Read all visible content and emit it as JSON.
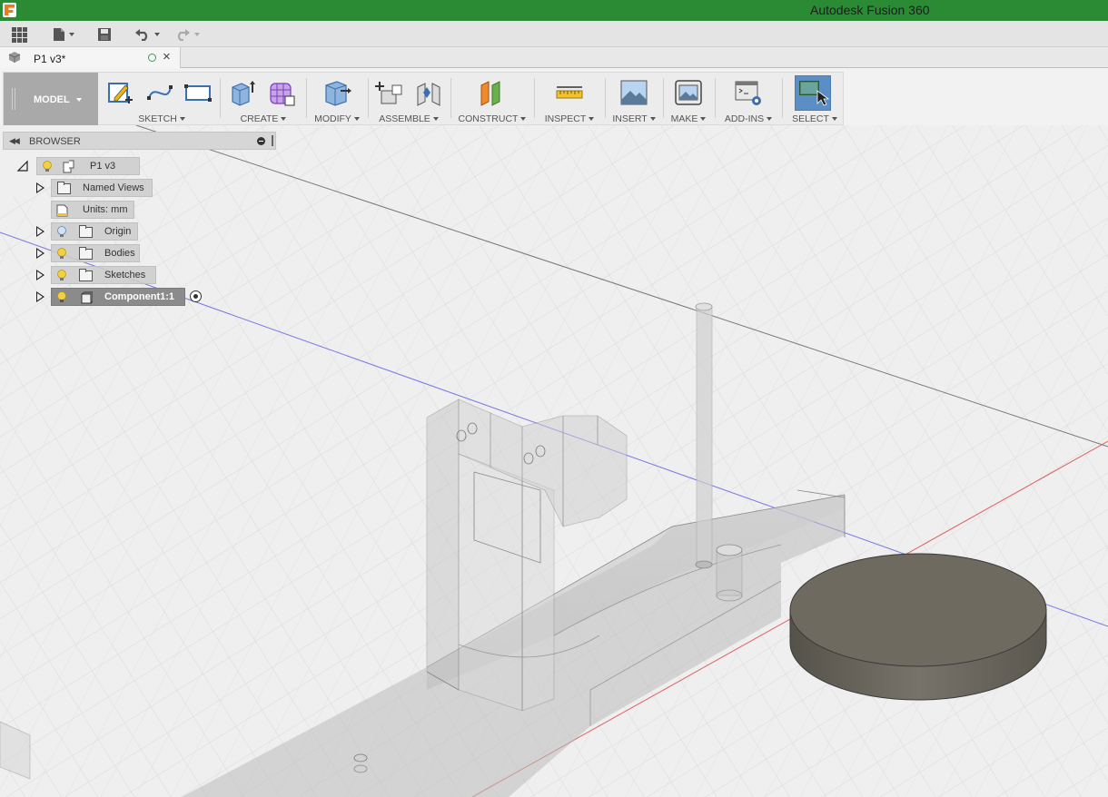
{
  "app": {
    "title": "Autodesk Fusion 360",
    "logo_icon": "fusion-logo-icon"
  },
  "quick_access": {
    "items": [
      {
        "name": "data-panel",
        "icon": "grid-icon"
      },
      {
        "name": "file-menu",
        "icon": "file-icon"
      },
      {
        "name": "save",
        "icon": "save-icon"
      },
      {
        "name": "undo",
        "icon": "undo-icon"
      },
      {
        "name": "redo",
        "icon": "redo-icon",
        "enabled": false
      }
    ]
  },
  "document_tab": {
    "title": "P1 v3*",
    "status": "saved-status-icon"
  },
  "workspace": {
    "label": "MODEL"
  },
  "toolbar": {
    "groups": [
      {
        "label": "SKETCH",
        "icons": [
          "create-sketch-icon",
          "spline-icon",
          "rectangle-icon"
        ]
      },
      {
        "label": "CREATE",
        "icons": [
          "extrude-icon",
          "form-icon"
        ]
      },
      {
        "label": "MODIFY",
        "icons": [
          "press-pull-icon"
        ]
      },
      {
        "label": "ASSEMBLE",
        "icons": [
          "new-component-icon",
          "joint-icon"
        ]
      },
      {
        "label": "CONSTRUCT",
        "icons": [
          "offset-plane-icon"
        ]
      },
      {
        "label": "INSPECT",
        "icons": [
          "measure-icon"
        ]
      },
      {
        "label": "INSERT",
        "icons": [
          "insert-image-icon"
        ]
      },
      {
        "label": "MAKE",
        "icons": [
          "3d-print-icon"
        ]
      },
      {
        "label": "ADD-INS",
        "icons": [
          "scripts-icon"
        ]
      },
      {
        "label": "SELECT",
        "icons": [
          "select-icon"
        ]
      }
    ]
  },
  "browser": {
    "title": "BROWSER",
    "root": {
      "label": "P1 v3"
    },
    "items": [
      {
        "label": "Named Views",
        "type": "folder",
        "visible_toggle": false
      },
      {
        "label": "Units: mm",
        "type": "units"
      },
      {
        "label": "Origin",
        "type": "folder",
        "bulb": "off"
      },
      {
        "label": "Bodies",
        "type": "folder",
        "bulb": "on"
      },
      {
        "label": "Sketches",
        "type": "folder",
        "bulb": "on"
      },
      {
        "label": "Component1:1",
        "type": "component",
        "bulb": "on",
        "active": true
      }
    ]
  },
  "colors": {
    "title_bar": "#2b8a34",
    "select_active": "#5b8ec4",
    "disc_body": "#6e6a5f",
    "axis_red": "#e05050",
    "axis_blue": "#6a6ae0"
  }
}
